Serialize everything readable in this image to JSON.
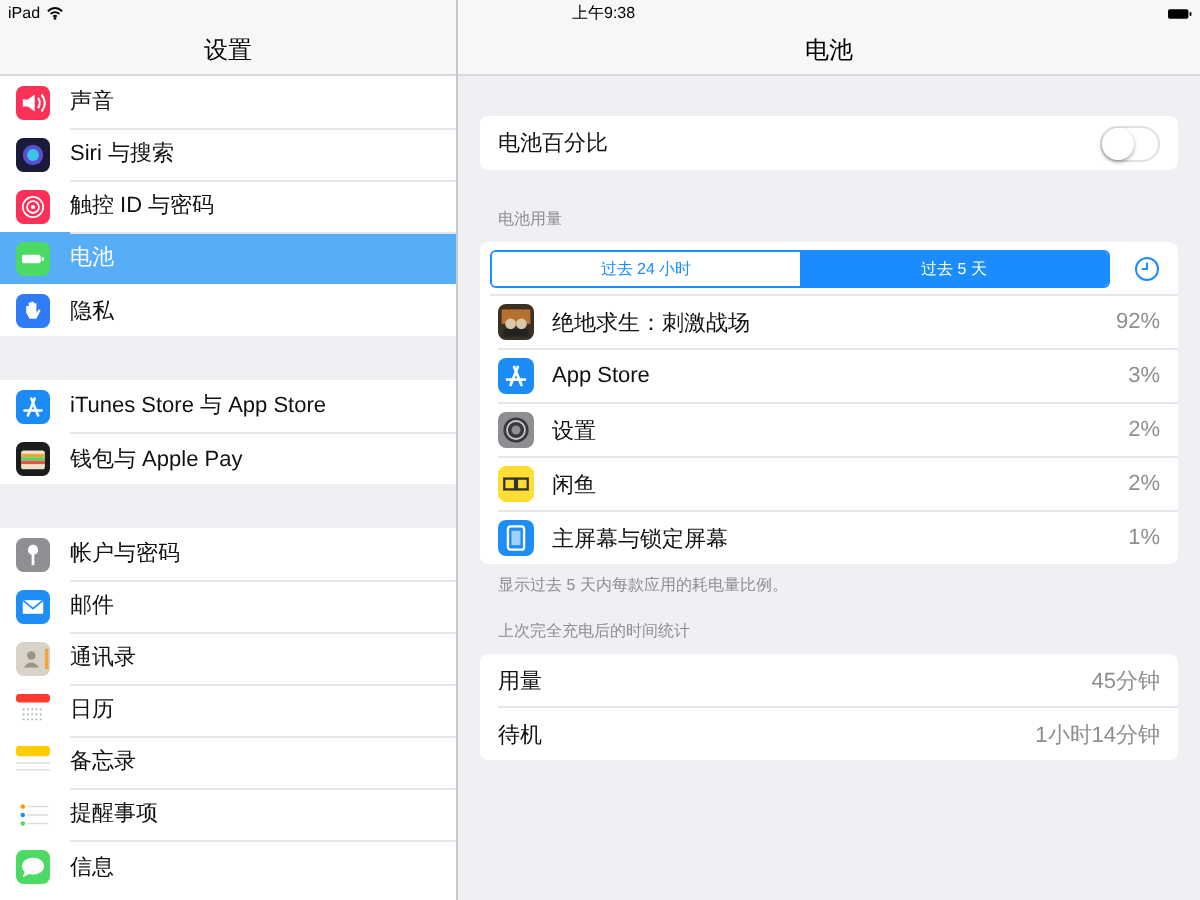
{
  "status_bar": {
    "device": "iPad",
    "time": "上午9:38"
  },
  "sidebar": {
    "title": "设置",
    "groups": [
      {
        "items": [
          {
            "label": "声音",
            "selected": false
          },
          {
            "label": "Siri 与搜索",
            "selected": false
          },
          {
            "label": "触控 ID 与密码",
            "selected": false
          },
          {
            "label": "电池",
            "selected": true
          },
          {
            "label": "隐私",
            "selected": false
          }
        ]
      },
      {
        "items": [
          {
            "label": "iTunes Store 与 App Store",
            "selected": false
          },
          {
            "label": "钱包与 Apple Pay",
            "selected": false
          }
        ]
      },
      {
        "items": [
          {
            "label": "帐户与密码",
            "selected": false
          },
          {
            "label": "邮件",
            "selected": false
          },
          {
            "label": "通讯录",
            "selected": false
          },
          {
            "label": "日历",
            "selected": false
          },
          {
            "label": "备忘录",
            "selected": false
          },
          {
            "label": "提醒事项",
            "selected": false
          },
          {
            "label": "信息",
            "selected": false
          }
        ]
      }
    ]
  },
  "detail": {
    "title": "电池",
    "battery_percentage": {
      "label": "电池百分比",
      "on": false
    },
    "usage": {
      "header": "电池用量",
      "segments": [
        {
          "label": "过去 24 小时",
          "selected": false
        },
        {
          "label": "过去 5 天",
          "selected": true
        }
      ],
      "apps": [
        {
          "name": "绝地求生：刺激战场",
          "percent": "92%"
        },
        {
          "name": "App Store",
          "percent": "3%"
        },
        {
          "name": "设置",
          "percent": "2%"
        },
        {
          "name": "闲鱼",
          "percent": "2%"
        },
        {
          "name": "主屏幕与锁定屏幕",
          "percent": "1%"
        }
      ],
      "footnote": "显示过去 5 天内每款应用的耗电量比例。"
    },
    "since_charge": {
      "header": "上次完全充电后的时间统计",
      "rows": [
        {
          "label": "用量",
          "value": "45分钟"
        },
        {
          "label": "待机",
          "value": "1小时14分钟"
        }
      ]
    }
  }
}
